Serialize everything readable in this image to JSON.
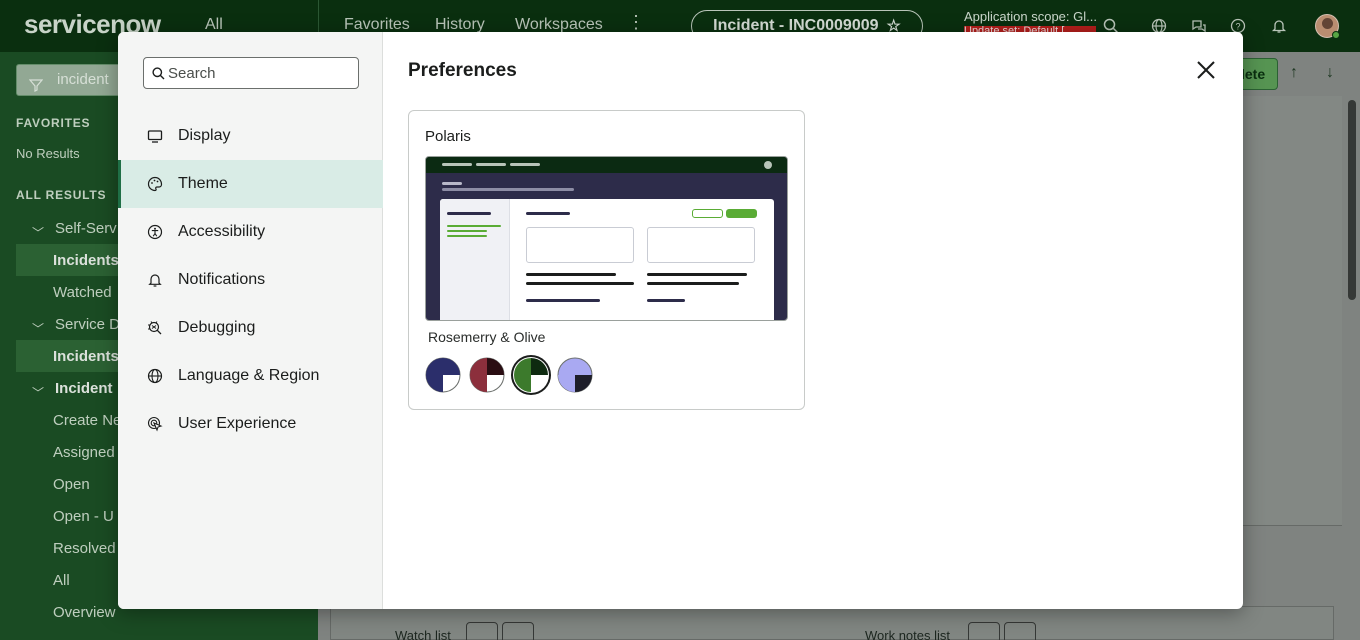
{
  "topbar": {
    "logo": "servicenow",
    "all": "All",
    "nav": [
      "Favorites",
      "History",
      "Workspaces"
    ],
    "incident_pill": "Incident - INC0009009",
    "scope": "Application scope: Gl...",
    "scope_warning": "Update set: Default [..."
  },
  "leftnav": {
    "filter_value": "incident",
    "favorites_header": "FAVORITES",
    "no_results": "No Results",
    "all_results_header": "ALL RESULTS",
    "items": [
      {
        "label": "Self-Serv",
        "chevron": true
      },
      {
        "label": "Incidents",
        "bold": true
      },
      {
        "label": "Watched",
        "bold": false
      },
      {
        "label": "Service D",
        "chevron": true
      },
      {
        "label": "Incidents",
        "bold": true
      },
      {
        "label": "Incident",
        "chevron": true,
        "bold": true
      },
      {
        "label": "Create Ne"
      },
      {
        "label": "Assigned"
      },
      {
        "label": "Open"
      },
      {
        "label": "Open - U"
      },
      {
        "label": "Resolved"
      },
      {
        "label": "All"
      },
      {
        "label": "Overview"
      }
    ]
  },
  "background": {
    "update_btn": "lete",
    "watch_list": "Watch list",
    "work_notes_list": "Work notes list"
  },
  "modal": {
    "search_placeholder": "Search",
    "title": "Preferences",
    "menu": [
      {
        "label": "Display",
        "icon": "monitor-icon"
      },
      {
        "label": "Theme",
        "icon": "palette-icon",
        "active": true
      },
      {
        "label": "Accessibility",
        "icon": "accessibility-icon"
      },
      {
        "label": "Notifications",
        "icon": "bell-icon"
      },
      {
        "label": "Debugging",
        "icon": "bug-icon"
      },
      {
        "label": "Language & Region",
        "icon": "globe-icon"
      },
      {
        "label": "User Experience",
        "icon": "cursor-click-icon"
      }
    ],
    "theme_card": {
      "title": "Polaris",
      "selected_variant": "Rosemerry & Olive",
      "swatches": [
        {
          "name": "navy",
          "colors": [
            "#2b2e6b",
            "#ffffff"
          ],
          "selected": false
        },
        {
          "name": "burgundy",
          "colors": [
            "#8c2f3c",
            "#2a0d12"
          ],
          "selected": false
        },
        {
          "name": "rosemerry-olive",
          "colors": [
            "#3c7a2c",
            "#0e2a10"
          ],
          "selected": true
        },
        {
          "name": "lavender",
          "colors": [
            "#a9a9f2",
            "#1e1e2a"
          ],
          "selected": false
        }
      ]
    }
  },
  "colors": {
    "accent": "#1f6f46",
    "active_bg": "#d9ece6",
    "preview_accent": "#5aac35"
  }
}
